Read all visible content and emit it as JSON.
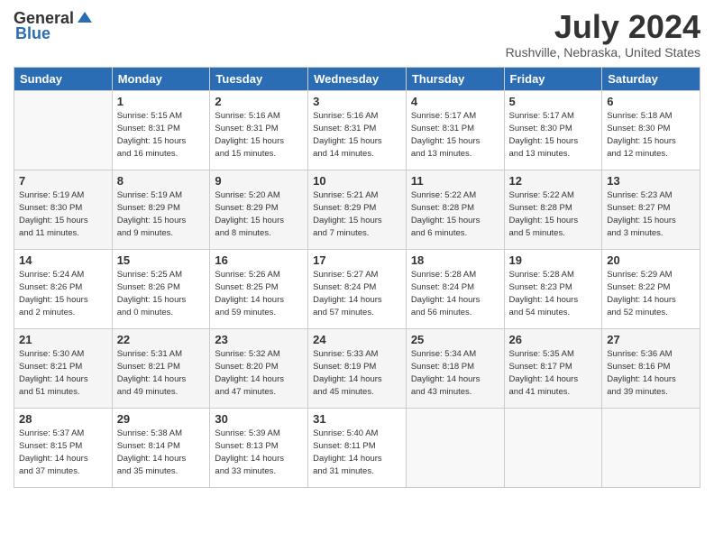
{
  "header": {
    "logo_general": "General",
    "logo_blue": "Blue",
    "month_title": "July 2024",
    "location": "Rushville, Nebraska, United States"
  },
  "days_of_week": [
    "Sunday",
    "Monday",
    "Tuesday",
    "Wednesday",
    "Thursday",
    "Friday",
    "Saturday"
  ],
  "weeks": [
    [
      {
        "day": "",
        "sunrise": "",
        "sunset": "",
        "daylight": ""
      },
      {
        "day": "1",
        "sunrise": "Sunrise: 5:15 AM",
        "sunset": "Sunset: 8:31 PM",
        "daylight": "Daylight: 15 hours and 16 minutes."
      },
      {
        "day": "2",
        "sunrise": "Sunrise: 5:16 AM",
        "sunset": "Sunset: 8:31 PM",
        "daylight": "Daylight: 15 hours and 15 minutes."
      },
      {
        "day": "3",
        "sunrise": "Sunrise: 5:16 AM",
        "sunset": "Sunset: 8:31 PM",
        "daylight": "Daylight: 15 hours and 14 minutes."
      },
      {
        "day": "4",
        "sunrise": "Sunrise: 5:17 AM",
        "sunset": "Sunset: 8:31 PM",
        "daylight": "Daylight: 15 hours and 13 minutes."
      },
      {
        "day": "5",
        "sunrise": "Sunrise: 5:17 AM",
        "sunset": "Sunset: 8:30 PM",
        "daylight": "Daylight: 15 hours and 13 minutes."
      },
      {
        "day": "6",
        "sunrise": "Sunrise: 5:18 AM",
        "sunset": "Sunset: 8:30 PM",
        "daylight": "Daylight: 15 hours and 12 minutes."
      }
    ],
    [
      {
        "day": "7",
        "sunrise": "Sunrise: 5:19 AM",
        "sunset": "Sunset: 8:30 PM",
        "daylight": "Daylight: 15 hours and 11 minutes."
      },
      {
        "day": "8",
        "sunrise": "Sunrise: 5:19 AM",
        "sunset": "Sunset: 8:29 PM",
        "daylight": "Daylight: 15 hours and 9 minutes."
      },
      {
        "day": "9",
        "sunrise": "Sunrise: 5:20 AM",
        "sunset": "Sunset: 8:29 PM",
        "daylight": "Daylight: 15 hours and 8 minutes."
      },
      {
        "day": "10",
        "sunrise": "Sunrise: 5:21 AM",
        "sunset": "Sunset: 8:29 PM",
        "daylight": "Daylight: 15 hours and 7 minutes."
      },
      {
        "day": "11",
        "sunrise": "Sunrise: 5:22 AM",
        "sunset": "Sunset: 8:28 PM",
        "daylight": "Daylight: 15 hours and 6 minutes."
      },
      {
        "day": "12",
        "sunrise": "Sunrise: 5:22 AM",
        "sunset": "Sunset: 8:28 PM",
        "daylight": "Daylight: 15 hours and 5 minutes."
      },
      {
        "day": "13",
        "sunrise": "Sunrise: 5:23 AM",
        "sunset": "Sunset: 8:27 PM",
        "daylight": "Daylight: 15 hours and 3 minutes."
      }
    ],
    [
      {
        "day": "14",
        "sunrise": "Sunrise: 5:24 AM",
        "sunset": "Sunset: 8:26 PM",
        "daylight": "Daylight: 15 hours and 2 minutes."
      },
      {
        "day": "15",
        "sunrise": "Sunrise: 5:25 AM",
        "sunset": "Sunset: 8:26 PM",
        "daylight": "Daylight: 15 hours and 0 minutes."
      },
      {
        "day": "16",
        "sunrise": "Sunrise: 5:26 AM",
        "sunset": "Sunset: 8:25 PM",
        "daylight": "Daylight: 14 hours and 59 minutes."
      },
      {
        "day": "17",
        "sunrise": "Sunrise: 5:27 AM",
        "sunset": "Sunset: 8:24 PM",
        "daylight": "Daylight: 14 hours and 57 minutes."
      },
      {
        "day": "18",
        "sunrise": "Sunrise: 5:28 AM",
        "sunset": "Sunset: 8:24 PM",
        "daylight": "Daylight: 14 hours and 56 minutes."
      },
      {
        "day": "19",
        "sunrise": "Sunrise: 5:28 AM",
        "sunset": "Sunset: 8:23 PM",
        "daylight": "Daylight: 14 hours and 54 minutes."
      },
      {
        "day": "20",
        "sunrise": "Sunrise: 5:29 AM",
        "sunset": "Sunset: 8:22 PM",
        "daylight": "Daylight: 14 hours and 52 minutes."
      }
    ],
    [
      {
        "day": "21",
        "sunrise": "Sunrise: 5:30 AM",
        "sunset": "Sunset: 8:21 PM",
        "daylight": "Daylight: 14 hours and 51 minutes."
      },
      {
        "day": "22",
        "sunrise": "Sunrise: 5:31 AM",
        "sunset": "Sunset: 8:21 PM",
        "daylight": "Daylight: 14 hours and 49 minutes."
      },
      {
        "day": "23",
        "sunrise": "Sunrise: 5:32 AM",
        "sunset": "Sunset: 8:20 PM",
        "daylight": "Daylight: 14 hours and 47 minutes."
      },
      {
        "day": "24",
        "sunrise": "Sunrise: 5:33 AM",
        "sunset": "Sunset: 8:19 PM",
        "daylight": "Daylight: 14 hours and 45 minutes."
      },
      {
        "day": "25",
        "sunrise": "Sunrise: 5:34 AM",
        "sunset": "Sunset: 8:18 PM",
        "daylight": "Daylight: 14 hours and 43 minutes."
      },
      {
        "day": "26",
        "sunrise": "Sunrise: 5:35 AM",
        "sunset": "Sunset: 8:17 PM",
        "daylight": "Daylight: 14 hours and 41 minutes."
      },
      {
        "day": "27",
        "sunrise": "Sunrise: 5:36 AM",
        "sunset": "Sunset: 8:16 PM",
        "daylight": "Daylight: 14 hours and 39 minutes."
      }
    ],
    [
      {
        "day": "28",
        "sunrise": "Sunrise: 5:37 AM",
        "sunset": "Sunset: 8:15 PM",
        "daylight": "Daylight: 14 hours and 37 minutes."
      },
      {
        "day": "29",
        "sunrise": "Sunrise: 5:38 AM",
        "sunset": "Sunset: 8:14 PM",
        "daylight": "Daylight: 14 hours and 35 minutes."
      },
      {
        "day": "30",
        "sunrise": "Sunrise: 5:39 AM",
        "sunset": "Sunset: 8:13 PM",
        "daylight": "Daylight: 14 hours and 33 minutes."
      },
      {
        "day": "31",
        "sunrise": "Sunrise: 5:40 AM",
        "sunset": "Sunset: 8:11 PM",
        "daylight": "Daylight: 14 hours and 31 minutes."
      },
      {
        "day": "",
        "sunrise": "",
        "sunset": "",
        "daylight": ""
      },
      {
        "day": "",
        "sunrise": "",
        "sunset": "",
        "daylight": ""
      },
      {
        "day": "",
        "sunrise": "",
        "sunset": "",
        "daylight": ""
      }
    ]
  ]
}
